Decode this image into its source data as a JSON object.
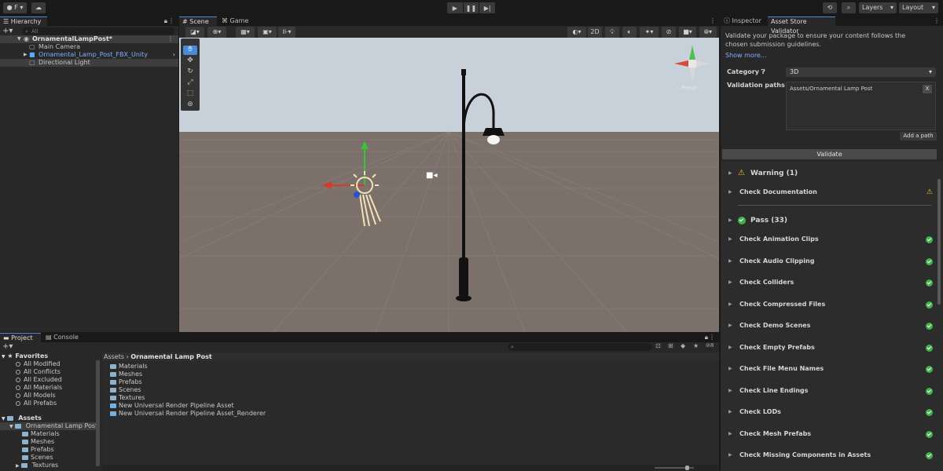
{
  "toolbar": {
    "account_label": "F",
    "layers_label": "Layers",
    "layout_label": "Layout"
  },
  "hierarchy": {
    "tab_label": "Hierarchy",
    "search_placeholder": "All",
    "scene_name": "OrnamentalLampPost*",
    "items": [
      {
        "label": "Main Camera"
      },
      {
        "label": "Ornamental_Lamp_Post_FBX_Unity"
      },
      {
        "label": "Directional Light"
      }
    ]
  },
  "scene": {
    "tab_scene": "Scene",
    "tab_game": "Game",
    "mode_2d": "2D",
    "persp_label": "‹ Persp"
  },
  "inspector": {
    "tab_inspector": "Inspector",
    "tab_validator": "Asset Store Validator",
    "description": "Validate your package to ensure your content follows the chosen submission guidelines.",
    "show_more": "Show more...",
    "category_label": "Category",
    "category_value": "3D",
    "paths_label": "Validation paths",
    "path_value": "Assets/Ornamental Lamp Post",
    "remove_label": "X",
    "add_path_label": "Add a path",
    "validate_label": "Validate",
    "warning_header": "Warning (1)",
    "warning_items": [
      "Check Documentation"
    ],
    "pass_header": "Pass (33)",
    "pass_items": [
      "Check Animation Clips",
      "Check Audio Clipping",
      "Check Colliders",
      "Check Compressed Files",
      "Check Demo Scenes",
      "Check Empty Prefabs",
      "Check File Menu Names",
      "Check Line Endings",
      "Check LODs",
      "Check Mesh Prefabs",
      "Check Missing Components in Assets"
    ]
  },
  "project": {
    "tab_project": "Project",
    "tab_console": "Console",
    "favorites_label": "Favorites",
    "favorites": [
      "All Modified",
      "All Conflicts",
      "All Excluded",
      "All Materials",
      "All Models",
      "All Prefabs"
    ],
    "assets_label": "Assets",
    "tree_selected": "Ornamental Lamp Post",
    "tree_children": [
      "Materials",
      "Meshes",
      "Prefabs",
      "Scenes",
      "Textures"
    ],
    "breadcrumb_root": "Assets",
    "breadcrumb_current": "Ornamental Lamp Post",
    "files": [
      "Materials",
      "Meshes",
      "Prefabs",
      "Scenes",
      "Textures",
      "New Universal Render Pipeline Asset",
      "New Universal Render Pipeline Asset_Renderer"
    ],
    "hidden_count": "8"
  },
  "colors": {
    "accent": "#4a8ad8",
    "pass_green": "#41b34c",
    "warning_yellow": "#f2c530",
    "link_blue": "#7fb0ff"
  }
}
